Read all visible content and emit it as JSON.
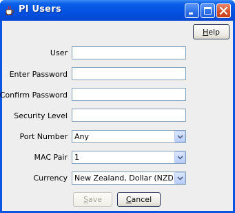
{
  "window": {
    "title": "PI Users",
    "icons": {
      "app": "java-coffee-cup-icon",
      "minimize": "minimize-icon",
      "maximize": "maximize-icon",
      "close": "close-icon"
    },
    "colors": {
      "titlebar": "#0351e0",
      "close_button": "#d6522c",
      "client_background": "#eeeeee"
    }
  },
  "help_button": {
    "label": "Help",
    "mnemonic": "H",
    "rest": "elp"
  },
  "form": {
    "user": {
      "label": "User",
      "value": ""
    },
    "enter_password": {
      "label": "Enter Password",
      "value": ""
    },
    "confirm_password": {
      "label": "Confirm Password",
      "value": ""
    },
    "security_level": {
      "label": "Security Level",
      "value": ""
    },
    "port_number": {
      "label": "Port Number",
      "selected": "Any"
    },
    "mac_pair": {
      "label": "MAC Pair",
      "selected": "1"
    },
    "currency": {
      "label": "Currency",
      "selected": "New Zealand, Dollar (NZD)"
    }
  },
  "footer": {
    "save_button": {
      "label": "Save",
      "mnemonic": "S",
      "rest": "ave",
      "enabled": false
    },
    "cancel_button": {
      "label": "Cancel",
      "mnemonic": "C",
      "rest": "ancel",
      "enabled": true
    }
  }
}
